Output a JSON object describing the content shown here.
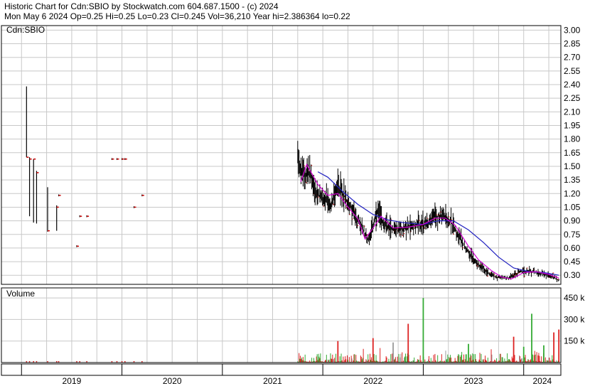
{
  "header": {
    "line1": "Historic Chart for Cdn:SBIO by Stockwatch.com 604.687.1500 - (c) 2024",
    "line2": "Mon May  6 2024  Op=0.25  Hi=0.25  Lo=0.23  Cl=0.245  Vol=36,210  Year hi=2.386364  lo=0.22"
  },
  "colors": {
    "background": "#ffffff",
    "grid": "#c8c8c8",
    "price_bar": "#000000",
    "close_tick": "#cc0000",
    "ma_short": "#d400d4",
    "ma_long": "#2020c0",
    "volume_up": "#33aa33",
    "volume_down": "#dd2222",
    "volume_flat": "#999999"
  },
  "chart_data": [
    {
      "type": "line",
      "title": "Cdn:SBIO",
      "ylim": [
        0.2,
        3.05
      ],
      "y_ticks": [
        "3.00",
        "2.85",
        "2.70",
        "2.55",
        "2.40",
        "2.25",
        "2.10",
        "1.95",
        "1.80",
        "1.65",
        "1.50",
        "1.35",
        "1.20",
        "1.05",
        "0.90",
        "0.75",
        "0.60",
        "0.45",
        "0.30"
      ],
      "x_labels": [
        "2019",
        "2020",
        "2021",
        "2022",
        "2023",
        "2024"
      ],
      "x_range": [
        2018.8,
        2024.37
      ],
      "sparse_bars": [
        {
          "x": 2019.05,
          "hi": 2.38,
          "lo": 1.6,
          "close": 1.6
        },
        {
          "x": 2019.08,
          "hi": 1.6,
          "lo": 0.95,
          "close": 1.58
        },
        {
          "x": 2019.12,
          "hi": 1.58,
          "lo": 0.88,
          "close": 1.58
        },
        {
          "x": 2019.15,
          "hi": 1.45,
          "lo": 0.87,
          "close": 1.43
        },
        {
          "x": 2019.26,
          "hi": 1.27,
          "lo": 0.78,
          "close": 0.79
        },
        {
          "x": 2019.35,
          "hi": 1.07,
          "lo": 0.79,
          "close": 1.05
        },
        {
          "x": 2019.37,
          "hi": 1.19,
          "lo": 1.17,
          "close": 1.18
        },
        {
          "x": 2019.55,
          "hi": 0.63,
          "lo": 0.61,
          "close": 0.62
        },
        {
          "x": 2019.58,
          "hi": 0.96,
          "lo": 0.94,
          "close": 0.95
        },
        {
          "x": 2019.65,
          "hi": 0.96,
          "lo": 0.94,
          "close": 0.95
        },
        {
          "x": 2019.9,
          "hi": 1.59,
          "lo": 1.57,
          "close": 1.58
        },
        {
          "x": 2019.95,
          "hi": 1.59,
          "lo": 1.57,
          "close": 1.58
        },
        {
          "x": 2020.0,
          "hi": 1.59,
          "lo": 1.57,
          "close": 1.58
        },
        {
          "x": 2020.03,
          "hi": 1.59,
          "lo": 1.57,
          "close": 1.58
        },
        {
          "x": 2020.12,
          "hi": 1.06,
          "lo": 1.04,
          "close": 1.05
        },
        {
          "x": 2020.2,
          "hi": 1.19,
          "lo": 1.17,
          "close": 1.18
        }
      ],
      "price_path": [
        [
          2021.75,
          1.7
        ],
        [
          2021.78,
          1.45
        ],
        [
          2021.82,
          1.4
        ],
        [
          2021.87,
          1.45
        ],
        [
          2021.92,
          1.2
        ],
        [
          2022.0,
          1.15
        ],
        [
          2022.08,
          1.05
        ],
        [
          2022.15,
          1.3
        ],
        [
          2022.25,
          1.1
        ],
        [
          2022.35,
          0.9
        ],
        [
          2022.45,
          0.7
        ],
        [
          2022.55,
          1.0
        ],
        [
          2022.62,
          0.85
        ],
        [
          2022.75,
          0.8
        ],
        [
          2022.9,
          0.85
        ],
        [
          2023.0,
          0.85
        ],
        [
          2023.12,
          0.95
        ],
        [
          2023.22,
          0.95
        ],
        [
          2023.3,
          0.85
        ],
        [
          2023.4,
          0.65
        ],
        [
          2023.52,
          0.45
        ],
        [
          2023.62,
          0.35
        ],
        [
          2023.72,
          0.28
        ],
        [
          2023.85,
          0.27
        ],
        [
          2023.95,
          0.33
        ],
        [
          2024.05,
          0.35
        ],
        [
          2024.15,
          0.33
        ],
        [
          2024.25,
          0.3
        ],
        [
          2024.35,
          0.245
        ]
      ],
      "ma_short": [
        [
          2021.78,
          1.33
        ],
        [
          2021.84,
          1.52
        ],
        [
          2021.95,
          1.3
        ],
        [
          2022.05,
          1.18
        ],
        [
          2022.15,
          1.2
        ],
        [
          2022.25,
          1.05
        ],
        [
          2022.35,
          0.92
        ],
        [
          2022.42,
          0.7
        ],
        [
          2022.5,
          0.82
        ],
        [
          2022.58,
          0.95
        ],
        [
          2022.7,
          0.82
        ],
        [
          2022.85,
          0.83
        ],
        [
          2023.0,
          0.86
        ],
        [
          2023.12,
          0.93
        ],
        [
          2023.22,
          0.93
        ],
        [
          2023.32,
          0.85
        ],
        [
          2023.45,
          0.62
        ],
        [
          2023.55,
          0.47
        ],
        [
          2023.68,
          0.35
        ],
        [
          2023.78,
          0.28
        ],
        [
          2023.88,
          0.26
        ],
        [
          2024.0,
          0.33
        ],
        [
          2024.12,
          0.34
        ],
        [
          2024.25,
          0.31
        ],
        [
          2024.35,
          0.27
        ]
      ],
      "ma_long": [
        [
          2021.95,
          1.44
        ],
        [
          2022.05,
          1.38
        ],
        [
          2022.2,
          1.22
        ],
        [
          2022.35,
          1.08
        ],
        [
          2022.5,
          0.97
        ],
        [
          2022.65,
          0.91
        ],
        [
          2022.8,
          0.88
        ],
        [
          2023.0,
          0.86
        ],
        [
          2023.15,
          0.9
        ],
        [
          2023.3,
          0.9
        ],
        [
          2023.45,
          0.8
        ],
        [
          2023.6,
          0.66
        ],
        [
          2023.75,
          0.5
        ],
        [
          2023.9,
          0.38
        ],
        [
          2024.05,
          0.34
        ],
        [
          2024.2,
          0.33
        ],
        [
          2024.35,
          0.3
        ]
      ]
    },
    {
      "type": "bar",
      "title": "Volume",
      "ylim": [
        0,
        520000
      ],
      "y_ticks": [
        "450 k",
        "300 k",
        "150 k"
      ],
      "y_tick_values": [
        450000,
        300000,
        150000
      ],
      "notable_bars": [
        {
          "x": 2023.0,
          "value": 450000,
          "color": "up"
        },
        {
          "x": 2024.08,
          "value": 340000,
          "color": "up"
        },
        {
          "x": 2022.85,
          "value": 270000,
          "color": "down"
        },
        {
          "x": 2023.9,
          "value": 180000,
          "color": "down"
        },
        {
          "x": 2024.35,
          "value": 230000,
          "color": "down"
        },
        {
          "x": 2024.3,
          "value": 210000,
          "color": "down"
        },
        {
          "x": 2022.5,
          "value": 170000,
          "color": "down"
        },
        {
          "x": 2022.15,
          "value": 150000,
          "color": "down"
        },
        {
          "x": 2022.7,
          "value": 140000,
          "color": "flat"
        },
        {
          "x": 2023.45,
          "value": 130000,
          "color": "up"
        },
        {
          "x": 2024.2,
          "value": 120000,
          "color": "up"
        },
        {
          "x": 2024.0,
          "value": 110000,
          "color": "up"
        }
      ]
    }
  ]
}
